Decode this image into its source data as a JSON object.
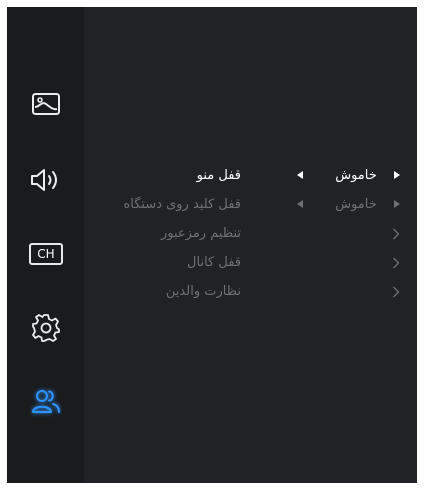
{
  "sidebar": {
    "items": [
      {
        "name": "picture",
        "icon": "picture-icon"
      },
      {
        "name": "sound",
        "icon": "speaker-icon"
      },
      {
        "name": "channel",
        "icon": "ch-icon",
        "label": "CH"
      },
      {
        "name": "settings",
        "icon": "gear-icon"
      },
      {
        "name": "parental",
        "icon": "users-icon",
        "selected": true
      }
    ],
    "accent_color": "#1e90ff"
  },
  "menu": {
    "items": [
      {
        "label": "قفل منو",
        "value": "خاموش",
        "type": "selector",
        "state": "active"
      },
      {
        "label": "قفل کلید روی دستگاه",
        "value": "خاموش",
        "type": "selector",
        "state": "dim"
      },
      {
        "label": "تنظیم رمزعبور",
        "type": "submenu",
        "state": "dim"
      },
      {
        "label": "قفل کانال",
        "type": "submenu",
        "state": "dim"
      },
      {
        "label": "نظارت والدین",
        "type": "submenu",
        "state": "dim"
      }
    ]
  },
  "colors": {
    "background": "#212225",
    "sidebar": "#1a1b1d",
    "text_active": "#ffffff",
    "text_dim": "#6f7076"
  }
}
